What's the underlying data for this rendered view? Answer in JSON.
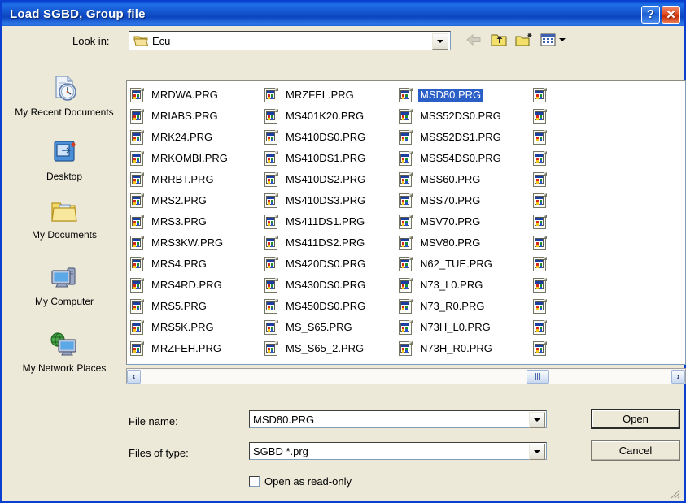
{
  "window": {
    "title": "Load SGBD, Group file",
    "help_button": "?",
    "close_button": "✕",
    "help_icon": "question-mark-icon",
    "close_icon": "close-x-icon"
  },
  "lookin": {
    "label": "Look in:",
    "value": "Ecu",
    "folder_icon": "open-folder-icon",
    "dropdown_icon": "chevron-down-icon"
  },
  "toolbar": {
    "items": [
      {
        "name": "back-button",
        "icon": "back-arrow-icon",
        "enabled": false
      },
      {
        "name": "up-one-level-button",
        "icon": "up-folder-icon",
        "enabled": true
      },
      {
        "name": "new-folder-button",
        "icon": "new-folder-icon",
        "enabled": true
      },
      {
        "name": "views-button",
        "icon": "views-menu-icon",
        "enabled": true
      }
    ]
  },
  "places": {
    "items": [
      {
        "label": "My Recent Documents",
        "icon": "recent-documents-icon"
      },
      {
        "label": "Desktop",
        "icon": "desktop-icon"
      },
      {
        "label": "My Documents",
        "icon": "my-documents-folder-icon"
      },
      {
        "label": "My Computer",
        "icon": "my-computer-icon"
      },
      {
        "label": "My Network Places",
        "icon": "network-places-icon"
      }
    ]
  },
  "filelist": {
    "selected": "MSD80.PRG",
    "file_icon": "prg-file-icon",
    "columns": [
      {
        "files": [
          "MRDWA.PRG",
          "MRIABS.PRG",
          "MRK24.PRG",
          "MRKOMBI.PRG",
          "MRRBT.PRG",
          "MRS2.PRG",
          "MRS3.PRG",
          "MRS3KW.PRG",
          "MRS4.PRG",
          "MRS4RD.PRG",
          "MRS5.PRG",
          "MRS5K.PRG",
          "MRZFEH.PRG"
        ]
      },
      {
        "files": [
          "MRZFEL.PRG",
          "MS401K20.PRG",
          "MS410DS0.PRG",
          "MS410DS1.PRG",
          "MS410DS2.PRG",
          "MS410DS3.PRG",
          "MS411DS1.PRG",
          "MS411DS2.PRG",
          "MS420DS0.PRG",
          "MS430DS0.PRG",
          "MS450DS0.PRG",
          "MS_S65.PRG",
          "MS_S65_2.PRG"
        ]
      },
      {
        "files": [
          "MSD80.PRG",
          "MSS52DS0.PRG",
          "MSS52DS1.PRG",
          "MSS54DS0.PRG",
          "MSS60.PRG",
          "MSS70.PRG",
          "MSV70.PRG",
          "MSV80.PRG",
          "N62_TUE.PRG",
          "N73_L0.PRG",
          "N73_R0.PRG",
          "N73H_L0.PRG",
          "N73H_R0.PRG"
        ]
      },
      {
        "files": [
          " ",
          " ",
          " ",
          " ",
          " ",
          " ",
          " ",
          " ",
          " ",
          " ",
          " ",
          " ",
          " "
        ]
      }
    ]
  },
  "scrollbar": {
    "left_arrow": "‹",
    "right_arrow": "›",
    "left_icon": "scroll-left-icon",
    "right_icon": "scroll-right-icon"
  },
  "bottom": {
    "filename_label": "File name:",
    "filename_value": "MSD80.PRG",
    "filetype_label": "Files of type:",
    "filetype_value": "SGBD *.prg",
    "readonly_label": "Open as read-only",
    "readonly_checked": false,
    "open_button": "Open",
    "cancel_button": "Cancel"
  },
  "colors": {
    "titlebar_blue": "#1456cf",
    "selection_blue": "#2a5fc8",
    "dialog_face": "#ece9d8",
    "border_blue": "#0a3fd0"
  }
}
